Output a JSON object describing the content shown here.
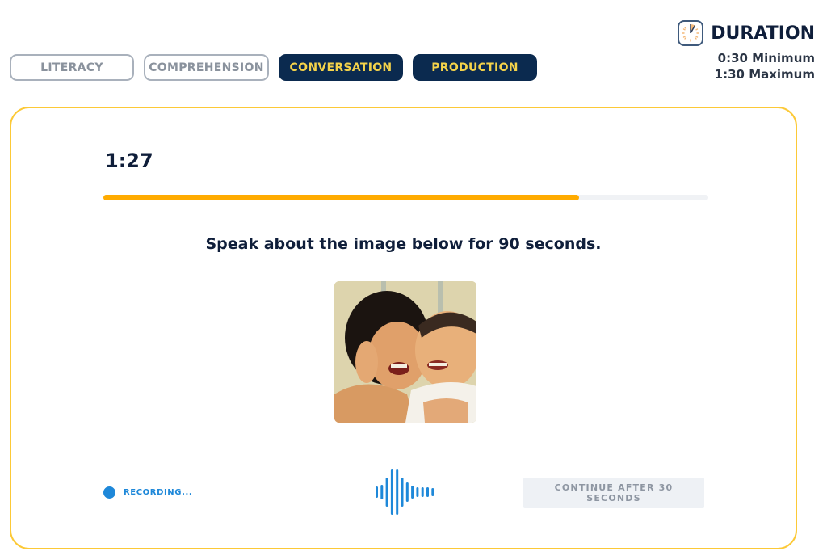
{
  "tabs": [
    {
      "label": "LITERACY",
      "state": "inactive"
    },
    {
      "label": "COMPREHENSION",
      "state": "inactive"
    },
    {
      "label": "CONVERSATION",
      "state": "active"
    },
    {
      "label": "PRODUCTION",
      "state": "active"
    }
  ],
  "duration": {
    "icon": "timer-icon",
    "title": "DURATION",
    "minimum": "0:30 Minimum",
    "maximum": "1:30 Maximum"
  },
  "task": {
    "timer": "1:27",
    "progress": 0.787,
    "prompt": "Speak about the image below for 90 seconds.",
    "image": {
      "description": "Two young children laughing cheek to cheek",
      "icon": "photo"
    }
  },
  "footer": {
    "recording_label": "RECORDING...",
    "waveform_icon": "audio-waveform-icon",
    "continue_label": "CONTINUE AFTER 30 SECONDS",
    "continue_enabled": false
  },
  "colors": {
    "accent_orange": "#ffab00",
    "card_border": "#fcc937",
    "navy": "#0b2a4f",
    "tab_active_text": "#f5d34a",
    "recording_blue": "#1e88d9"
  }
}
